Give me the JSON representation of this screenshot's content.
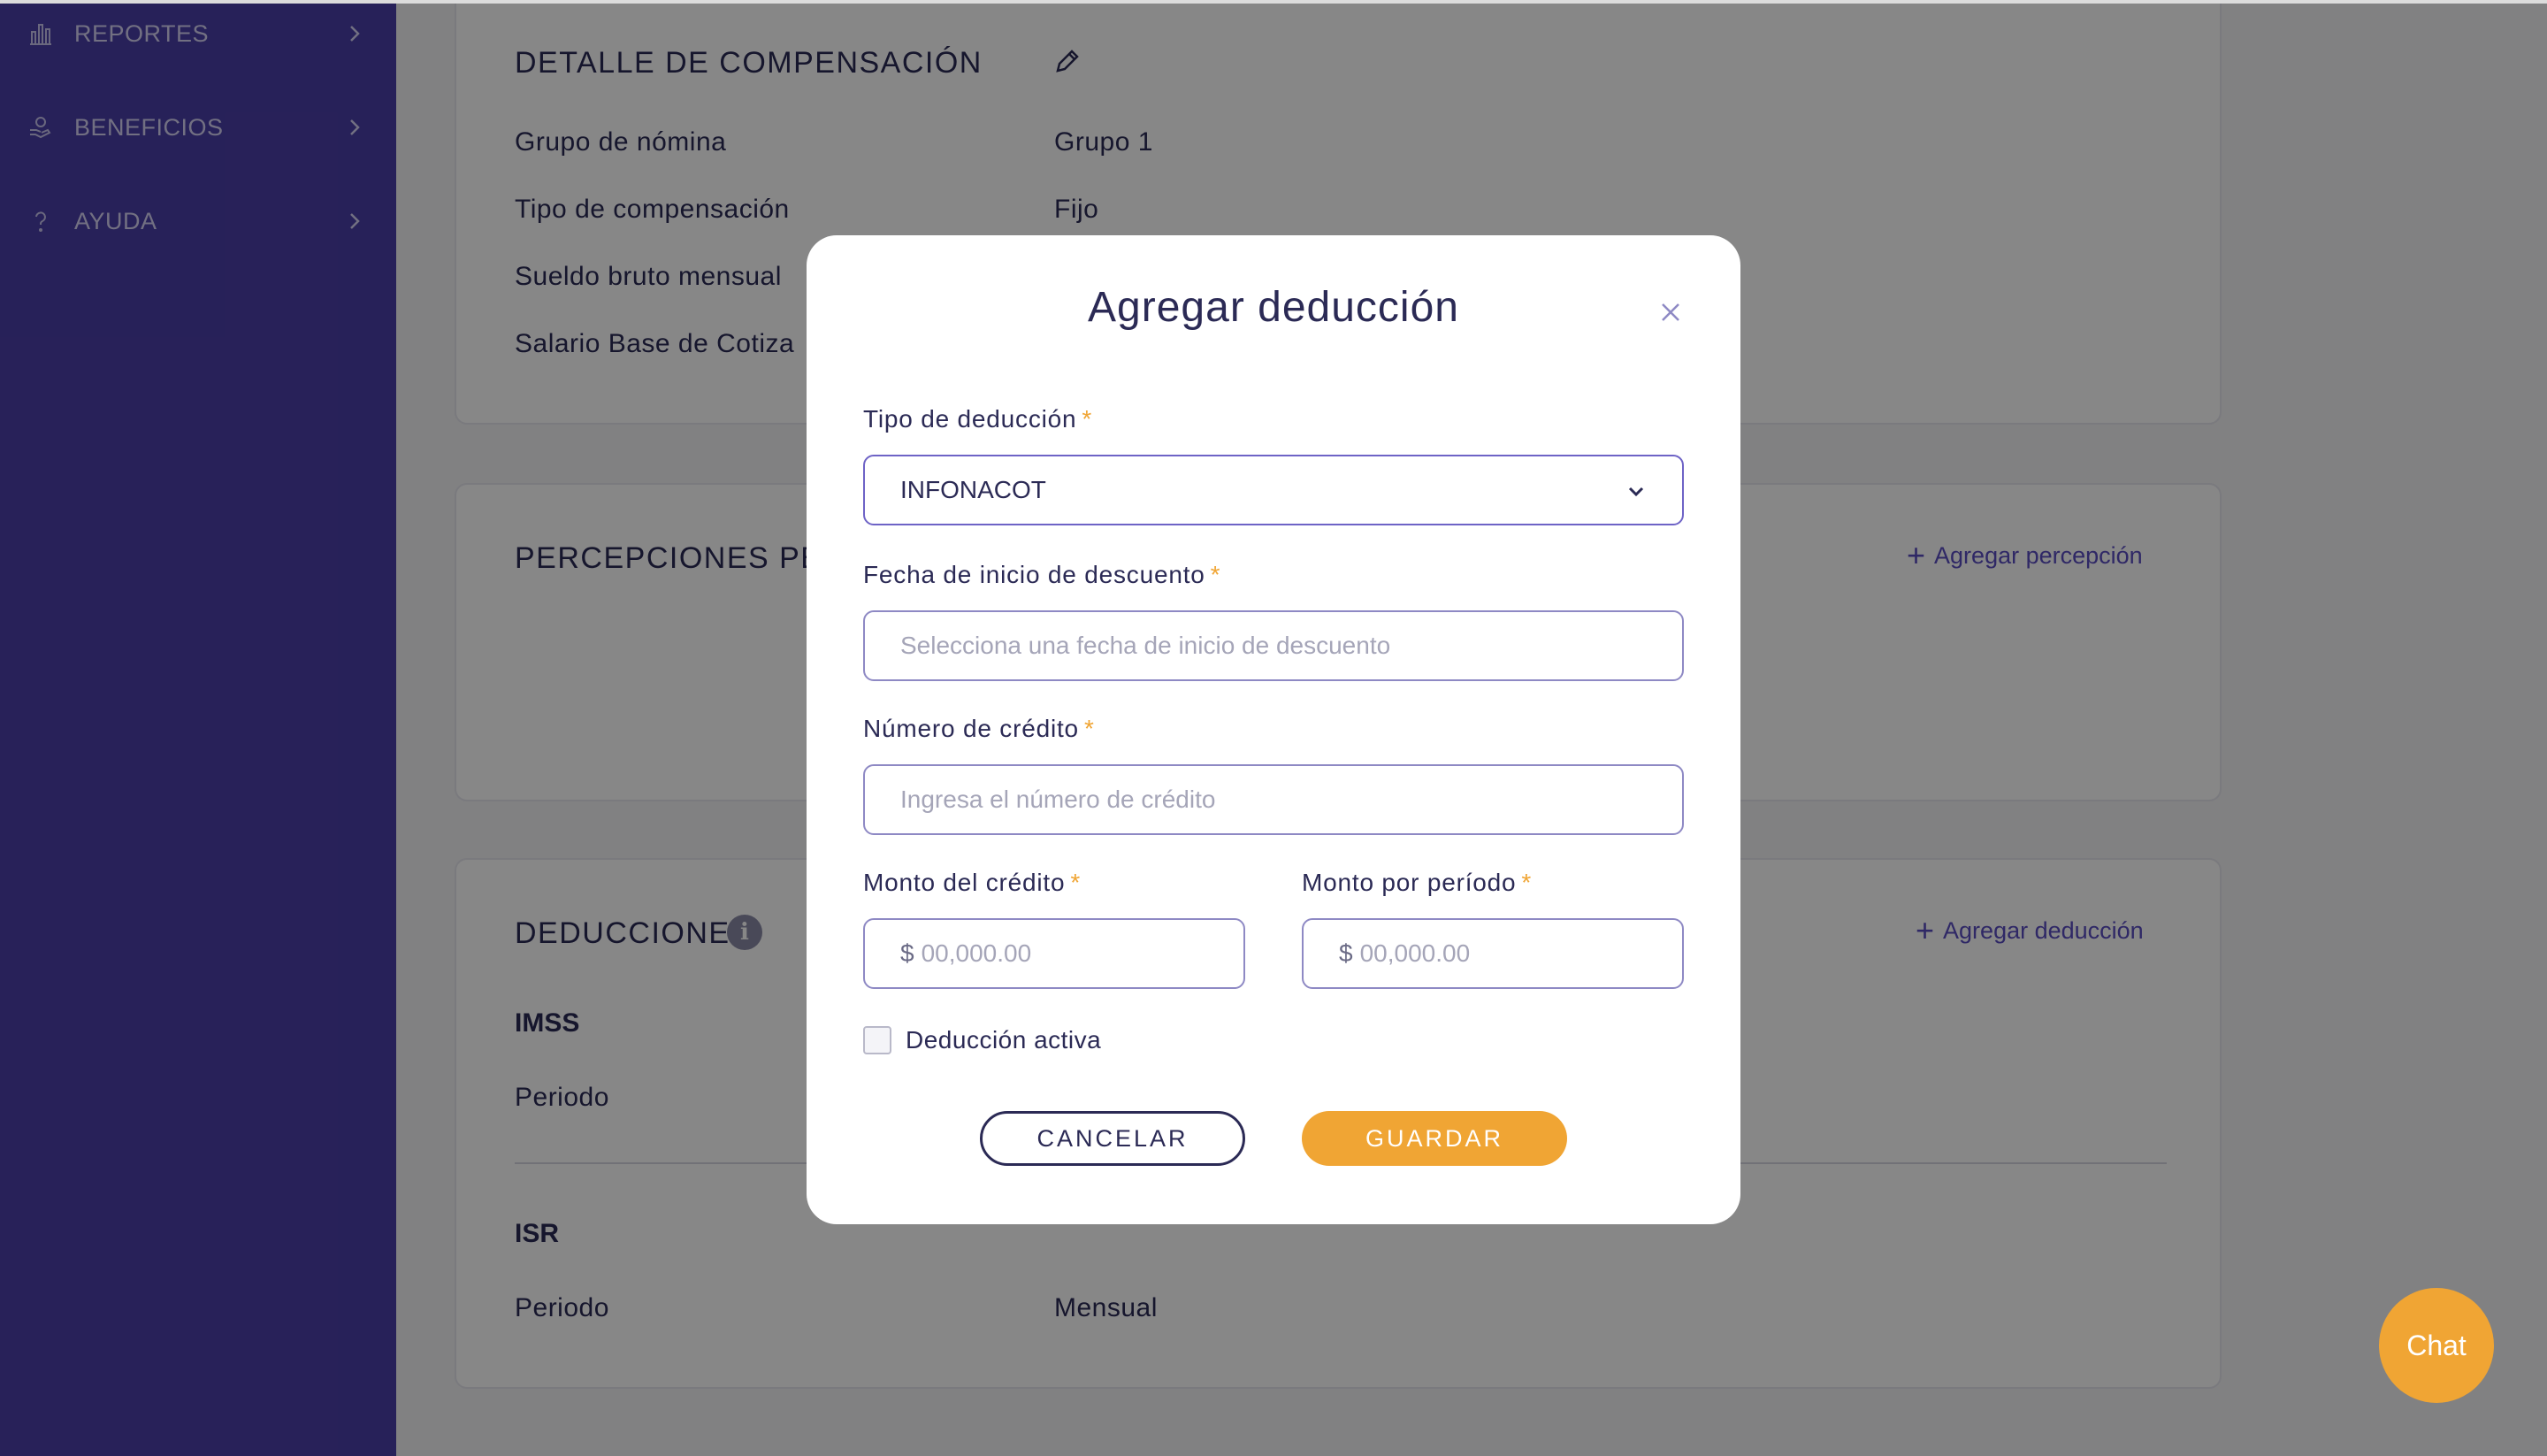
{
  "sidebar": {
    "items": [
      {
        "label": "REPORTES",
        "icon": "bar-chart-icon"
      },
      {
        "label": "BENEFICIOS",
        "icon": "hand-benefits-icon"
      },
      {
        "label": "AYUDA",
        "icon": "help-icon"
      }
    ]
  },
  "compensation": {
    "title": "DETALLE DE COMPENSACIÓN",
    "rows": [
      {
        "label": "Grupo de nómina",
        "value": "Grupo 1"
      },
      {
        "label": "Tipo de compensación",
        "value": "Fijo"
      },
      {
        "label": "Sueldo bruto mensual",
        "value": ""
      },
      {
        "label": "Salario Base de Cotiza",
        "value": ""
      }
    ]
  },
  "perceptions": {
    "title": "PERCEPCIONES PE",
    "add_label": "Agregar percepción"
  },
  "deductions": {
    "title": "DEDUCCIONES",
    "add_label": "Agregar deducción",
    "items": [
      {
        "name": "IMSS",
        "period_label": "Periodo",
        "period_value": ""
      },
      {
        "name": "ISR",
        "period_label": "Periodo",
        "period_value": "Mensual"
      }
    ]
  },
  "modal": {
    "title": "Agregar deducción",
    "type_label": "Tipo de deducción",
    "type_value": "INFONACOT",
    "start_date_label": "Fecha de inicio de descuento",
    "start_date_placeholder": "Selecciona una fecha de inicio de descuento",
    "credit_number_label": "Número de crédito",
    "credit_number_placeholder": "Ingresa el número de crédito",
    "credit_amount_label": "Monto del crédito",
    "credit_amount_prefix": "$",
    "credit_amount_placeholder": "00,000.00",
    "period_amount_label": "Monto por período",
    "period_amount_prefix": "$",
    "period_amount_placeholder": "00,000.00",
    "active_label": "Deducción activa",
    "active_checked": false,
    "required_mark": "*",
    "cancel_label": "CANCELAR",
    "save_label": "GUARDAR"
  },
  "chat": {
    "label": "Chat"
  },
  "colors": {
    "sidebar": "#4b3fa8",
    "accent": "#f0a534",
    "text": "#2b2a55",
    "link": "#5a4cc0"
  }
}
